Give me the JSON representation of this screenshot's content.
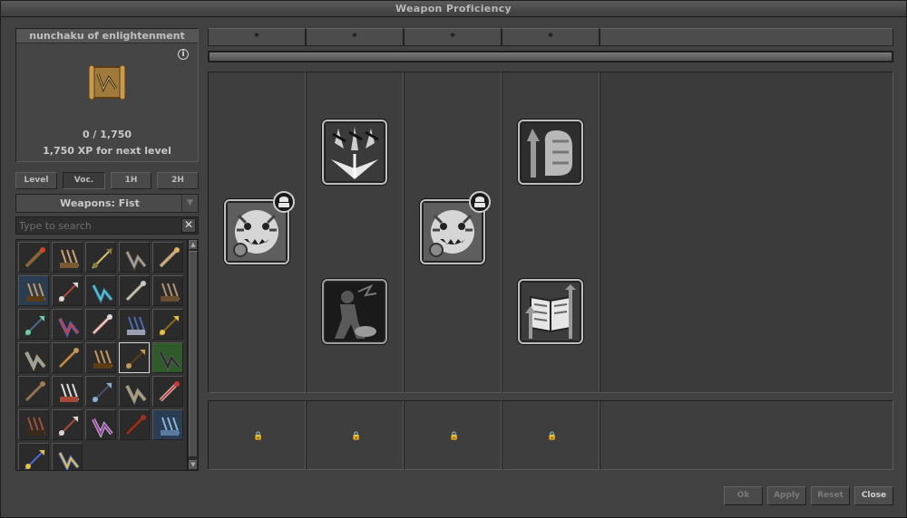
{
  "window": {
    "title": "Weapon Proficiency"
  },
  "item": {
    "name": "nunchaku of enlightenment",
    "info_symbol": "i",
    "xp_progress": "0 / 1,750",
    "xp_next": "1,750 XP for next level",
    "sprite_icon": "nunchaku-scroll-icon"
  },
  "tabs": [
    {
      "label": "Level",
      "active": false
    },
    {
      "label": "Voc.",
      "active": true
    },
    {
      "label": "1H",
      "active": false
    },
    {
      "label": "2H",
      "active": false
    }
  ],
  "category": {
    "selected": "Weapons: Fist",
    "arrow": "▼"
  },
  "search": {
    "placeholder": "Type to search",
    "value": "",
    "clear_symbol": "✕"
  },
  "items": [
    {
      "icon": "flame-whip-icon",
      "state": "normal"
    },
    {
      "icon": "staff-icon",
      "state": "normal"
    },
    {
      "icon": "rod-icon",
      "state": "normal"
    },
    {
      "icon": "spear-icon",
      "state": "normal"
    },
    {
      "icon": "claw-gauntlet-icon",
      "state": "normal"
    },
    {
      "icon": "nunchaku-icon",
      "state": "blue"
    },
    {
      "icon": "claws-icon",
      "state": "normal"
    },
    {
      "icon": "ice-wand-icon",
      "state": "normal"
    },
    {
      "icon": "sword-icon",
      "state": "normal"
    },
    {
      "icon": "fist-wrap-icon",
      "state": "normal"
    },
    {
      "icon": "wand-icon",
      "state": "normal"
    },
    {
      "icon": "fire-claw-icon",
      "state": "normal"
    },
    {
      "icon": "claws-icon",
      "state": "normal"
    },
    {
      "icon": "lance-icon",
      "state": "normal"
    },
    {
      "icon": "golden-gauntlet-icon",
      "state": "normal"
    },
    {
      "icon": "scythe-icon",
      "state": "normal"
    },
    {
      "icon": "nunchaku-icon",
      "state": "normal"
    },
    {
      "icon": "nunchaku-icon",
      "state": "normal"
    },
    {
      "icon": "nunchaku-icon",
      "state": "selected"
    },
    {
      "icon": "black-gloves-icon",
      "state": "green"
    },
    {
      "icon": "wrapped-fist-icon",
      "state": "normal"
    },
    {
      "icon": "claws-icon",
      "state": "normal"
    },
    {
      "icon": "dagger-icon",
      "state": "normal"
    },
    {
      "icon": "halberd-icon",
      "state": "normal"
    },
    {
      "icon": "red-claw-icon",
      "state": "normal"
    },
    {
      "icon": "bow-icon",
      "state": "normal"
    },
    {
      "icon": "claws-icon",
      "state": "normal"
    },
    {
      "icon": "purple-axe-icon",
      "state": "normal"
    },
    {
      "icon": "red-staff-icon",
      "state": "normal"
    },
    {
      "icon": "crossbow-icon",
      "state": "blue"
    },
    {
      "icon": "golden-blade-icon",
      "state": "normal"
    },
    {
      "icon": "golden-blade-icon",
      "state": "normal"
    }
  ],
  "stars": [
    "*",
    "*",
    "*",
    "*"
  ],
  "level_progress_fraction": 1.0,
  "perks": [
    {
      "column": 1,
      "icon": "tiger-head-icon",
      "badge": "upgrade-badge-icon"
    },
    {
      "column": 2,
      "icon": "triple-strike-icon"
    },
    {
      "column": 2,
      "icon": "shadow-figure-icon"
    },
    {
      "column": 3,
      "icon": "tiger-head-icon",
      "badge": "upgrade-badge-icon"
    },
    {
      "column": 4,
      "icon": "fist-up-icon"
    },
    {
      "column": 4,
      "icon": "tome-up-icon"
    }
  ],
  "locks": [
    "🔒",
    "🔒",
    "🔒",
    "🔒"
  ],
  "buttons": {
    "ok": "Ok",
    "apply": "Apply",
    "reset": "Reset",
    "close": "Close"
  }
}
